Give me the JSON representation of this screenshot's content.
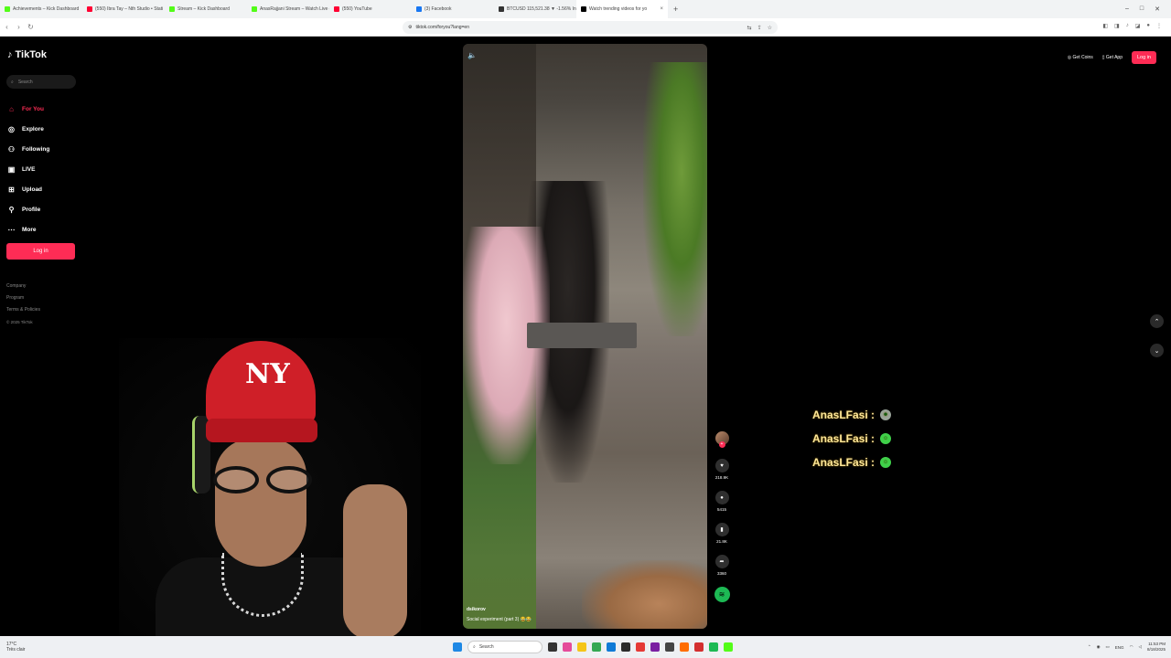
{
  "browser": {
    "tabs": [
      {
        "label": "Achievements – Kick Dashboard",
        "color": "#53fc18"
      },
      {
        "label": "(550) Ibra Tay – Nth Studio • Stati",
        "color": "#ff0033"
      },
      {
        "label": "Stream – Kick Dashboard",
        "color": "#53fc18"
      },
      {
        "label": "AnasRajjani Stream – Watch Live on K",
        "color": "#53fc18"
      },
      {
        "label": "(550) YouTube",
        "color": "#ff0033"
      },
      {
        "label": "(3) Facebook",
        "color": "#1877f2"
      },
      {
        "label": "BTCUSD 115,521.38 ▼ -1.56% Inc...",
        "color": "#333333"
      },
      {
        "label": "Watch trending videos for yo",
        "color": "#000000",
        "active": true
      }
    ],
    "new_tab": "+",
    "url": "tiktok.com/foryou?lang=en"
  },
  "tiktok": {
    "logo": "TikTok",
    "search_placeholder": "Search",
    "nav": [
      {
        "label": "For You",
        "icon": "home-icon",
        "active": true
      },
      {
        "label": "Explore",
        "icon": "compass-icon"
      },
      {
        "label": "Following",
        "icon": "following-icon"
      },
      {
        "label": "LIVE",
        "icon": "live-icon"
      },
      {
        "label": "Upload",
        "icon": "upload-icon"
      },
      {
        "label": "Profile",
        "icon": "profile-icon"
      },
      {
        "label": "More",
        "icon": "more-icon"
      }
    ],
    "login": "Log in",
    "footer": [
      "Company",
      "Program",
      "Terms & Policies"
    ],
    "copyright": "© 2025 TikTok",
    "top_right": {
      "coins": "Get Coins",
      "app": "Get App",
      "login": "Log in"
    },
    "video": {
      "author": "dsikorov",
      "caption": "Social experiment (part 3) 😂😂"
    },
    "actions": {
      "likes": "218.9K",
      "comments": "5415",
      "saves": "21.8K",
      "shares": "3360"
    }
  },
  "chat": [
    {
      "user": "AnasLFasi :",
      "emoji": "alien-emoji"
    },
    {
      "user": "AnasLFasi :",
      "emoji": "green-emoji"
    },
    {
      "user": "AnasLFasi :",
      "emoji": "green-emoji"
    }
  ],
  "taskbar": {
    "weather_temp": "17°C",
    "weather_desc": "Très clair",
    "search": "Search",
    "lang": "ENG",
    "time": "11:53 PM",
    "date": "8/18/2025"
  },
  "colors": {
    "accent": "#fe2c55",
    "chat_text": "#ffe89a"
  }
}
